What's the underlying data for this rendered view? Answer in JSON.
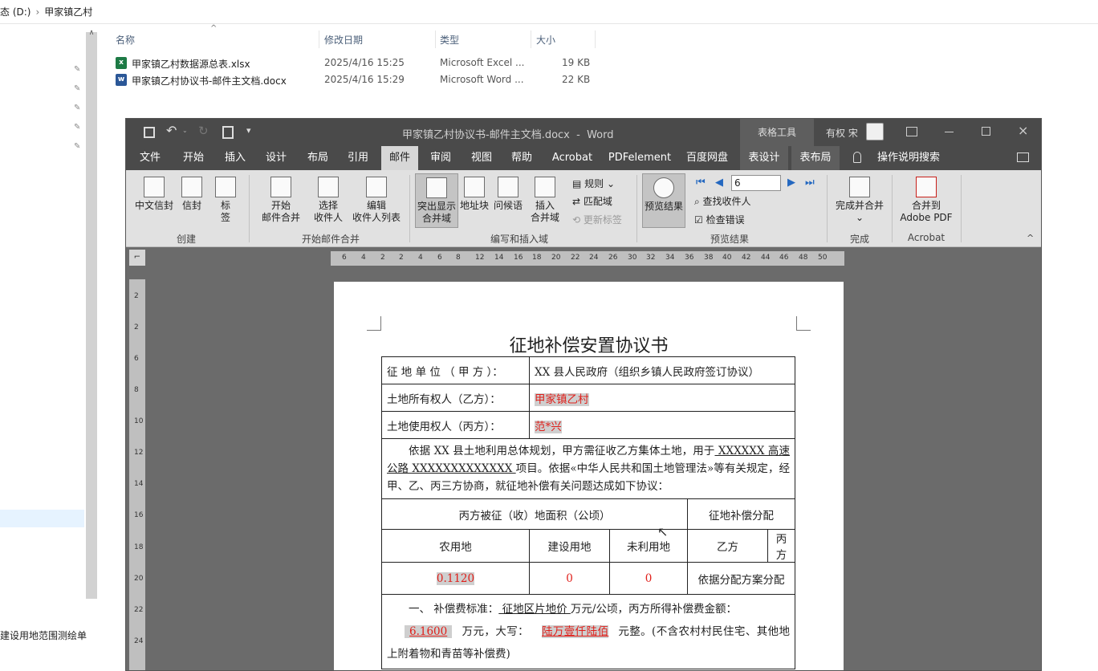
{
  "explorer": {
    "breadcrumb": [
      "态 (D:)",
      "›",
      "甲家镇乙村"
    ],
    "columns": {
      "name": "名称",
      "modified": "修改日期",
      "type": "类型",
      "size": "大小"
    },
    "files": [
      {
        "icon": "excel-icon",
        "name": "甲家镇乙村数据源总表.xlsx",
        "modified": "2025/4/16 15:25",
        "type": "Microsoft Excel ...",
        "size": "19 KB"
      },
      {
        "icon": "word-icon",
        "name": "甲家镇乙村协议书-邮件主文档.docx",
        "modified": "2025/4/16 15:29",
        "type": "Microsoft Word ...",
        "size": "22 KB"
      }
    ],
    "side_text": "建设用地范围测绘单"
  },
  "word": {
    "title": "甲家镇乙村协议书-邮件主文档.docx  -  Word",
    "table_tools": "表格工具",
    "user": "有权 宋",
    "tabs": [
      "文件",
      "开始",
      "插入",
      "设计",
      "布局",
      "引用",
      "邮件",
      "审阅",
      "视图",
      "帮助",
      "Acrobat",
      "PDFelement",
      "百度网盘",
      "表设计",
      "表布局",
      "操作说明搜索"
    ],
    "ribbon": {
      "create": {
        "label": "创建",
        "buttons": [
          "中文信封",
          "信封",
          "标\n签"
        ]
      },
      "start_merge": {
        "label": "开始邮件合并",
        "buttons": [
          "开始\n邮件合并",
          "选择\n收件人",
          "编辑\n收件人列表"
        ]
      },
      "write_insert": {
        "label": "编写和插入域",
        "buttons": [
          "突出显示\n合并域",
          "地址块",
          "问候语",
          "插入\n合并域"
        ],
        "small": [
          "规则",
          "匹配域",
          "更新标签"
        ]
      },
      "preview": {
        "label": "预览结果",
        "button": "预览结果",
        "record": "6",
        "small": [
          "查找收件人",
          "检查错误"
        ]
      },
      "finish": {
        "label": "完成",
        "button": "完成并合并"
      },
      "acrobat": {
        "label": "Acrobat",
        "button": "合并到\nAdobe PDF"
      }
    },
    "hruler_labels": [
      "6",
      "4",
      "2",
      "2",
      "4",
      "6",
      "8",
      "12",
      "14",
      "16",
      "18",
      "20",
      "22",
      "24",
      "26",
      "30",
      "32",
      "34",
      "36",
      "38",
      "40",
      "42",
      "44",
      "46",
      "48",
      "50"
    ],
    "vruler_labels": [
      "2",
      "2",
      "6",
      "8",
      "10",
      "12",
      "14",
      "16",
      "18",
      "20",
      "22",
      "24"
    ]
  },
  "document": {
    "title": "征地补偿安置协议书",
    "party_a_label": "征 地 单 位 （ 甲 方 ）：",
    "party_a_value": "XX 县人民政府（组织乡镇人民政府签订协议）",
    "party_b_label": "土地所有权人（乙方）：",
    "party_b_value": "甲家镇乙村",
    "party_c_label": "土地使用权人（丙方）：",
    "party_c_value": "范*兴",
    "para_1": "依据 XX 县土地利用总体规划，甲方需征收乙方集体土地，用于",
    "para_1_link": " XXXXXX 高速公路 XXXXXXXXXXXXX ",
    "para_1_tail": "项目。依据«中华人民共和国土地管理法»等有关规定，经甲、乙、丙三方协商，就征地补偿有关问题达成如下协议：",
    "area_header": "丙方被征（收）地面积（公顷）",
    "comp_header": "征地补偿分配",
    "cols": [
      "农用地",
      "建设用地",
      "未利用地",
      "乙方",
      "丙方"
    ],
    "values": [
      "0.1120",
      "0",
      "0"
    ],
    "alloc": "依据分配方案分配",
    "comp_1": "一、 补偿费标准：",
    "comp_price": " 征地区片地价 ",
    "comp_2": "万元/公顷，丙方所得补偿费金额：",
    "comp_amount": "6.1600",
    "comp_3": "万元，大写：",
    "comp_upper": "陆万壹仟陆佰",
    "comp_4": "元整。(不含农村村民住宅、其他地上附着物和青苗等补偿费)"
  }
}
